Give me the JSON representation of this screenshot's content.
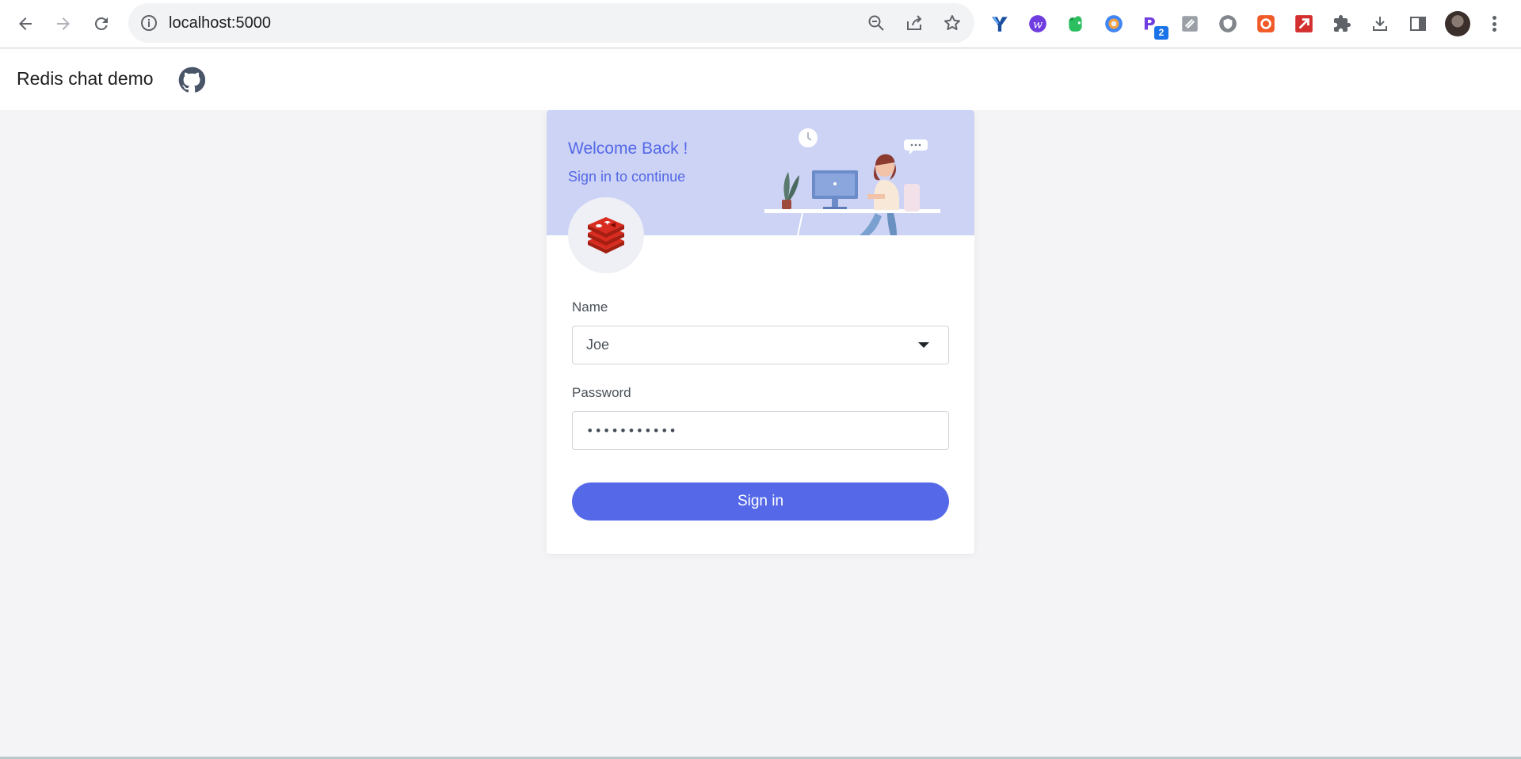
{
  "browser": {
    "url": "localhost:5000",
    "extension_badge_count": "2",
    "icons": [
      "back-arrow-icon",
      "forward-arrow-icon",
      "reload-icon",
      "info-icon",
      "zoom-out-icon",
      "share-icon",
      "bookmark-star-icon",
      "puzzle-icon",
      "download-icon",
      "side-panel-icon",
      "profile-avatar",
      "more-menu-icon"
    ]
  },
  "app": {
    "title": "Redis chat demo",
    "github_icon": "github-icon"
  },
  "login": {
    "welcome": "Welcome Back !",
    "subtitle": "Sign in to continue",
    "name_label": "Name",
    "name_value": "Joe",
    "password_label": "Password",
    "password_value": "password123",
    "submit_label": "Sign in"
  },
  "colors": {
    "accent": "#5569e8",
    "banner": "#cdd3f5",
    "background": "#f4f4f6"
  }
}
